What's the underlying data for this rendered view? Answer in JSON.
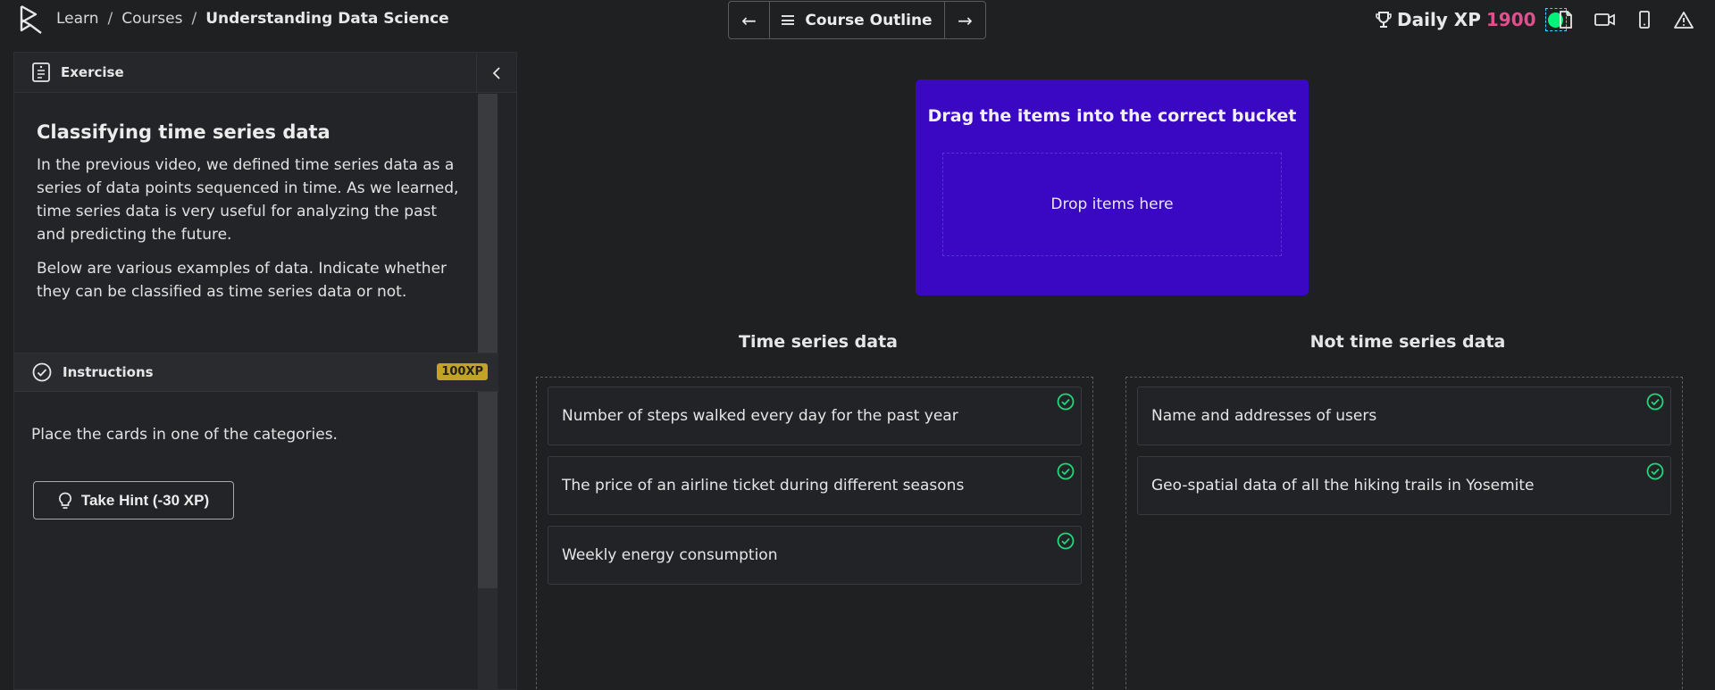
{
  "breadcrumb": {
    "items": [
      "Learn",
      "Courses",
      "Understanding Data Science"
    ],
    "separator": "/"
  },
  "nav": {
    "outline_label": "Course Outline",
    "prev_icon": "arrow-left-icon",
    "next_icon": "arrow-right-icon"
  },
  "xp": {
    "label": "Daily XP",
    "value": "1900",
    "value_color": "#e0508f",
    "status_color": "#05f27a"
  },
  "top_icons": [
    "document-icon",
    "video-icon",
    "mobile-icon",
    "warning-icon"
  ],
  "exercise": {
    "header_label": "Exercise",
    "title": "Classifying time series data",
    "paragraph1": "In the previous video, we defined time series data as a series of data points sequenced in time. As we learned, time series data is very useful for analyzing the past and predicting the future.",
    "paragraph2": "Below are various examples of data. Indicate whether they can be classified as time series data or not."
  },
  "instructions": {
    "label": "Instructions",
    "xp_badge": "100XP",
    "text": "Place the cards in one of the categories.",
    "hint_button": "Take Hint (-30 XP)"
  },
  "drag": {
    "title": "Drag the items into the correct bucket",
    "drop_placeholder": "Drop items here",
    "accent_color": "#3a08c2"
  },
  "buckets": {
    "left": {
      "title": "Time series data",
      "cards": [
        "Number of steps walked every day for the past year",
        "The price of an airline ticket during different seasons",
        "Weekly energy consumption"
      ]
    },
    "right": {
      "title": "Not time series data",
      "cards": [
        "Name and addresses of users",
        "Geo-spatial data of all the hiking trails in Yosemite"
      ]
    },
    "check_color": "#22d67b"
  }
}
